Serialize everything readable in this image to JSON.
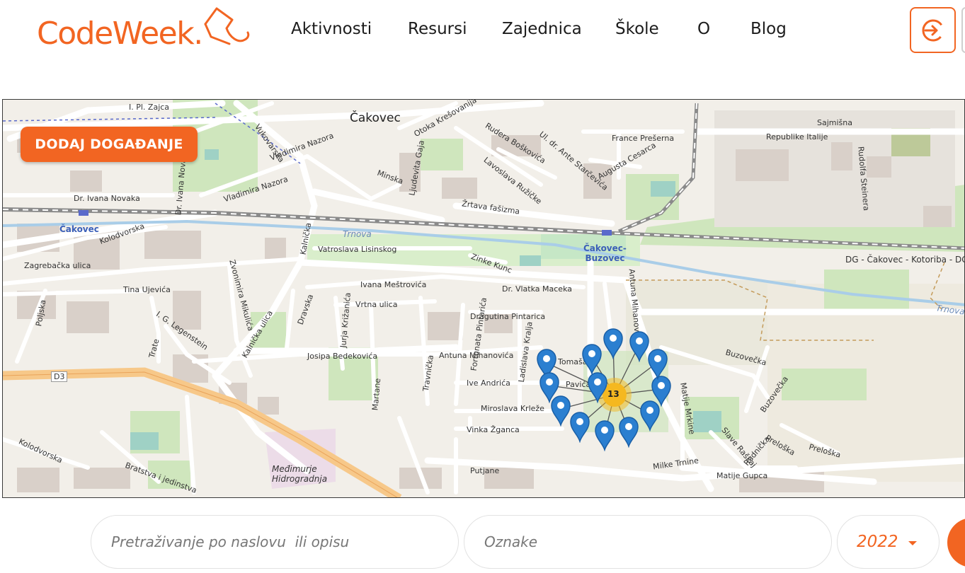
{
  "logo": {
    "text": "CodeWeek."
  },
  "nav": {
    "items": [
      {
        "label": "Aktivnosti"
      },
      {
        "label": "Resursi"
      },
      {
        "label": "Zajednica"
      },
      {
        "label": "Škole"
      },
      {
        "label": "O"
      },
      {
        "label": "Blog"
      }
    ]
  },
  "header": {
    "login_icon": "sign-in-icon"
  },
  "map": {
    "add_event_label": "DODAJ DOGAĐANJE",
    "cluster_count": "13",
    "labels": {
      "city": "Čakovec",
      "station_west": "Čakovec",
      "station_east": "Čakovec-\nBuzovec",
      "water1": "Trnova",
      "water2": "Trnova",
      "railway": "DG - Čakovec - Kotoriba - DG",
      "s1": "I. Pl. Zajca",
      "s2": "Vukovarska",
      "s3": "Vladimira Nazora",
      "s4": "Vladimira Nazora",
      "s5": "Dr. Ivana Novaka",
      "s6": "Dr. Ivana Novaka",
      "s7": "Otoka Krešovanija",
      "s8": "Rudera Boškovića",
      "s9": "Ul. dr. Ante Starčevića",
      "s10": "Lavoslava Ružičke",
      "s11": "Žrtava fašizma",
      "s12": "Ljudevita Gaja",
      "s13": "Minska",
      "s14": "Augusta Cesarca",
      "s15": "France Prešerna",
      "s16": "Sajmišna",
      "s17": "Republike Italije",
      "s18": "Rudolfa Steinera",
      "s19": "Kolodvorska",
      "s20": "Zagrebačka ulica",
      "s21": "Vatroslava Lisinskog",
      "s22": "Tina Ujevića",
      "s23": "Zinke Kunc",
      "s24": "Ivana Meštrovića",
      "s25": "Dr. Vlatka Maceka",
      "s26": "Vrtna ulica",
      "s27": "Josipa Bedekovića",
      "s28": "Antuna Mihanovića",
      "s29": "Ive Andrića",
      "s30": "Miroslava Krleže",
      "s31": "Vinka Žganca",
      "s32": "Putjane",
      "s33": "Milke Trnine",
      "s34": "Matije Gupca",
      "s35": "Buzovečka",
      "s36": "Buzovečka",
      "s37": "Preloška",
      "s38": "Preloška",
      "s39": "Slave Raškaj",
      "s40": "Radnička",
      "s41": "Međimurje\nHidrogradnja",
      "s42": "Bratstva i jedinstva",
      "s43": "D3",
      "s44": "Tomaša",
      "s45": "Pavića",
      "s46": "Dragutina Pintarica",
      "s47": "Fortunata Pintarića",
      "s48": "Ladislava Kralja",
      "s49": "Travnička",
      "s50": "Martane",
      "s51": "Jurja Križanića",
      "s52": "Dravska",
      "s53": "Kalnička ulica",
      "s54": "Zvonimira Mikulića",
      "s55": "Kalnička",
      "s56": "I. G. Legenstein",
      "s57": "Trate",
      "s58": "Poljska",
      "s59": "Kolodvorska",
      "s60": "Antuna Mihanovića",
      "s61": "Matije Mrkine"
    }
  },
  "search": {
    "title_placeholder": "Pretraživanje po naslovu  ili opisu",
    "tags_placeholder": "Oznake",
    "year": "2022"
  },
  "colors": {
    "accent": "#f26522",
    "marker": "#2b7fd0",
    "cluster": "#f5b820"
  }
}
